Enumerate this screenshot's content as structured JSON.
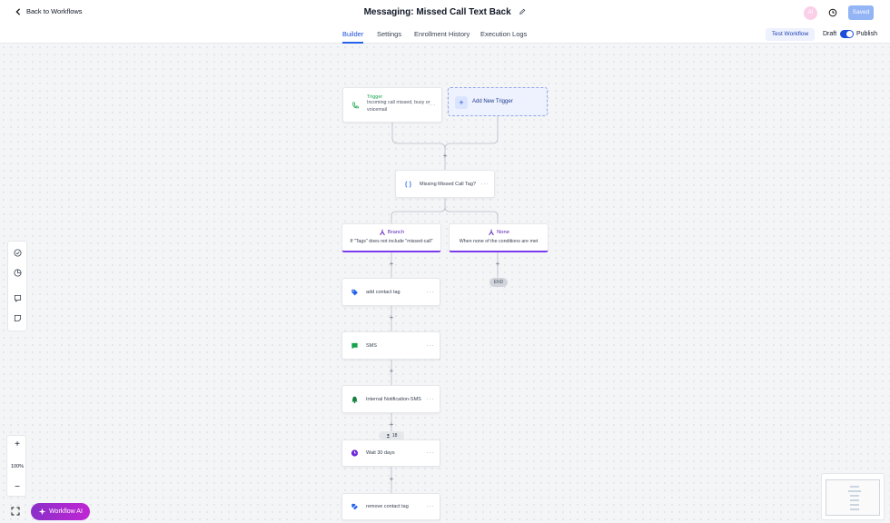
{
  "header": {
    "back_label": "Back to Workflows",
    "title": "Messaging: Missed Call Text Back",
    "avatar_initials": "AI",
    "saved_label": "Saved"
  },
  "tabs": [
    {
      "label": "Builder",
      "active": true
    },
    {
      "label": "Settings",
      "active": false
    },
    {
      "label": "Enrollment History",
      "active": false
    },
    {
      "label": "Execution Logs",
      "active": false
    }
  ],
  "controls": {
    "test_label": "Test Workflow",
    "draft_label": "Draft",
    "publish_label": "Publish",
    "publish_on": true
  },
  "trigger": {
    "title": "Trigger",
    "description": "Incoming call missed, busy or voicemail",
    "icon": "phone-icon"
  },
  "add_trigger_label": "Add New Trigger",
  "condition": {
    "label": "Missing Missed Call Tag?",
    "icon": "braces-icon"
  },
  "branches": [
    {
      "title": "Branch",
      "description": "If \"Tags\" does not include \"missed-call\""
    },
    {
      "title": "None",
      "description": "When none of the conditions are met"
    }
  ],
  "end_label": "END",
  "actions": [
    {
      "label": "add contact tag",
      "icon": "tag-icon",
      "color": "#2563eb"
    },
    {
      "label": "SMS",
      "icon": "message-icon",
      "color": "#16a34a"
    },
    {
      "label": "Internal Notification-SMS",
      "icon": "bell-icon",
      "color": "#15803d"
    },
    {
      "label": "Wait 30 days",
      "icon": "clock-icon",
      "color": "#6d28d9"
    },
    {
      "label": "remove contact tag",
      "icon": "tag-remove-icon",
      "color": "#2563eb"
    }
  ],
  "enrolled_count": "18",
  "zoom": {
    "level": "100%"
  },
  "ai_button_label": "Workflow AI",
  "colors": {
    "accent": "#2563eb",
    "branch": "#7c3aed",
    "trigger": "#16a34a",
    "ai": "#a21caf"
  }
}
